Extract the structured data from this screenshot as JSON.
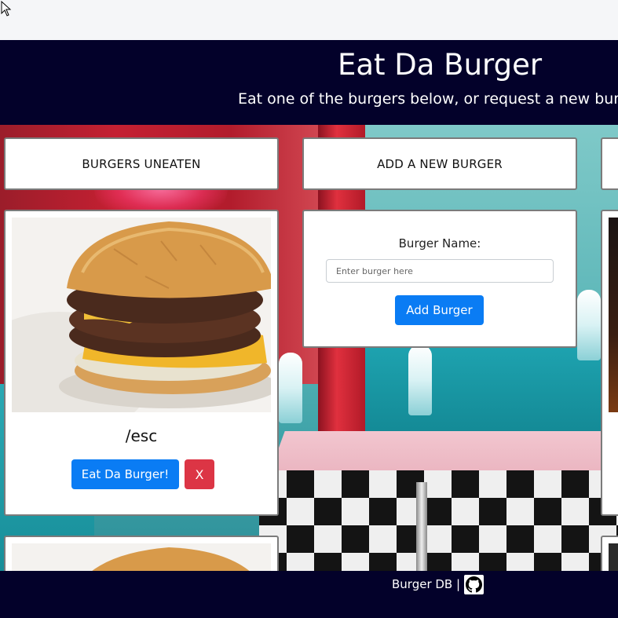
{
  "header": {
    "title": "Eat Da Burger",
    "subtitle": "Eat one of the burgers below, or request a new burger"
  },
  "columns": {
    "uneaten_heading": "BURGERS UNEATEN",
    "add_heading": "ADD A NEW BURGER"
  },
  "burgers": [
    {
      "name": "/esc",
      "eat_label": "Eat Da Burger!",
      "delete_label": "X"
    }
  ],
  "add_form": {
    "label": "Burger Name:",
    "placeholder": "Enter burger here",
    "value": "",
    "button_label": "Add Burger"
  },
  "footer": {
    "text": "Burger DB |",
    "icon": "github-icon"
  },
  "colors": {
    "header_bg": "#03012a",
    "primary_button": "#0a7cf4",
    "danger_button": "#dc3545"
  }
}
